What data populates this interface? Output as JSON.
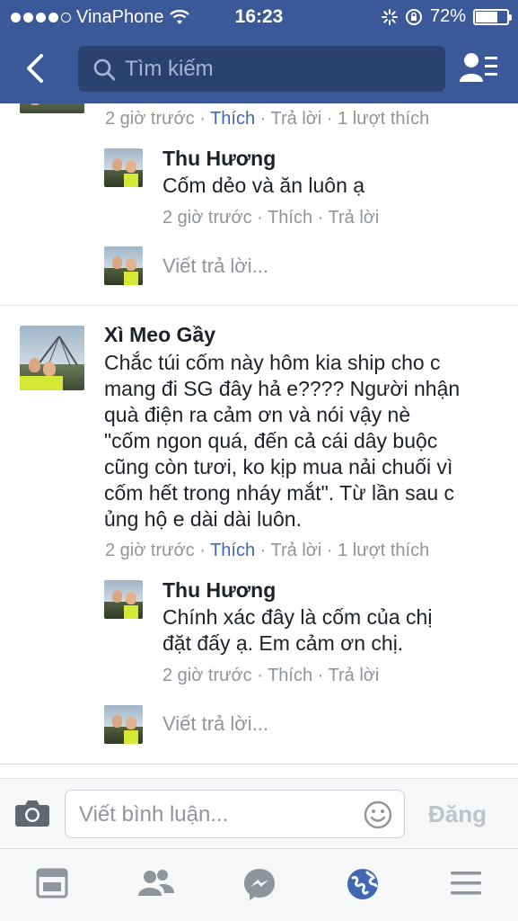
{
  "status_bar": {
    "carrier": "VinaPhone",
    "time": "16:23",
    "battery": "72%",
    "battery_level": 0.72
  },
  "nav": {
    "search_placeholder": "Tìm kiếm"
  },
  "top_comment_meta": {
    "time": "2 giờ trước",
    "like": "Thích",
    "reply": "Trả lời",
    "likes": "1 lượt thích"
  },
  "threads": [
    {
      "reply": {
        "name": "Thu Hương",
        "text": "Cốm dẻo và ăn luôn ạ",
        "time": "2 giờ trước",
        "like": "Thích",
        "reply": "Trả lời"
      },
      "reply_placeholder": "Viết trả lời..."
    },
    {
      "comment": {
        "name": "Xì Meo Gầy",
        "lines": [
          "Chắc túi cốm này hôm kia ship cho c",
          "mang đi SG đây hả e???? Người nhận",
          "quà điện ra cảm ơn và nói vậy nè",
          "\"cốm ngon quá, đến cả cái dây buộc",
          "cũng còn tươi, ko kịp mua nải chuối vì",
          "cốm hết trong nháy mắt\". Từ lần sau c",
          "ủng hộ e dài dài luôn."
        ],
        "time": "2 giờ trước",
        "like": "Thích",
        "reply": "Trả lời",
        "likes": "1 lượt thích"
      },
      "reply": {
        "name": "Thu Hương",
        "lines": [
          "Chính xác đây là cốm của chị",
          "đặt đấy ạ. Em cảm ơn chị."
        ],
        "time": "2 giờ trước",
        "like": "Thích",
        "reply": "Trả lời"
      },
      "reply_placeholder": "Viết trả lời..."
    }
  ],
  "composer": {
    "placeholder": "Viết bình luận...",
    "post_label": "Đăng"
  },
  "tabs": [
    "news-feed-icon",
    "friends-icon",
    "messenger-icon",
    "notifications-globe-icon",
    "menu-icon"
  ],
  "colors": {
    "brand": "#3b5998",
    "link_blue": "#4267b2",
    "active_tab": "#4267b2",
    "meta_gray": "#90949c"
  }
}
